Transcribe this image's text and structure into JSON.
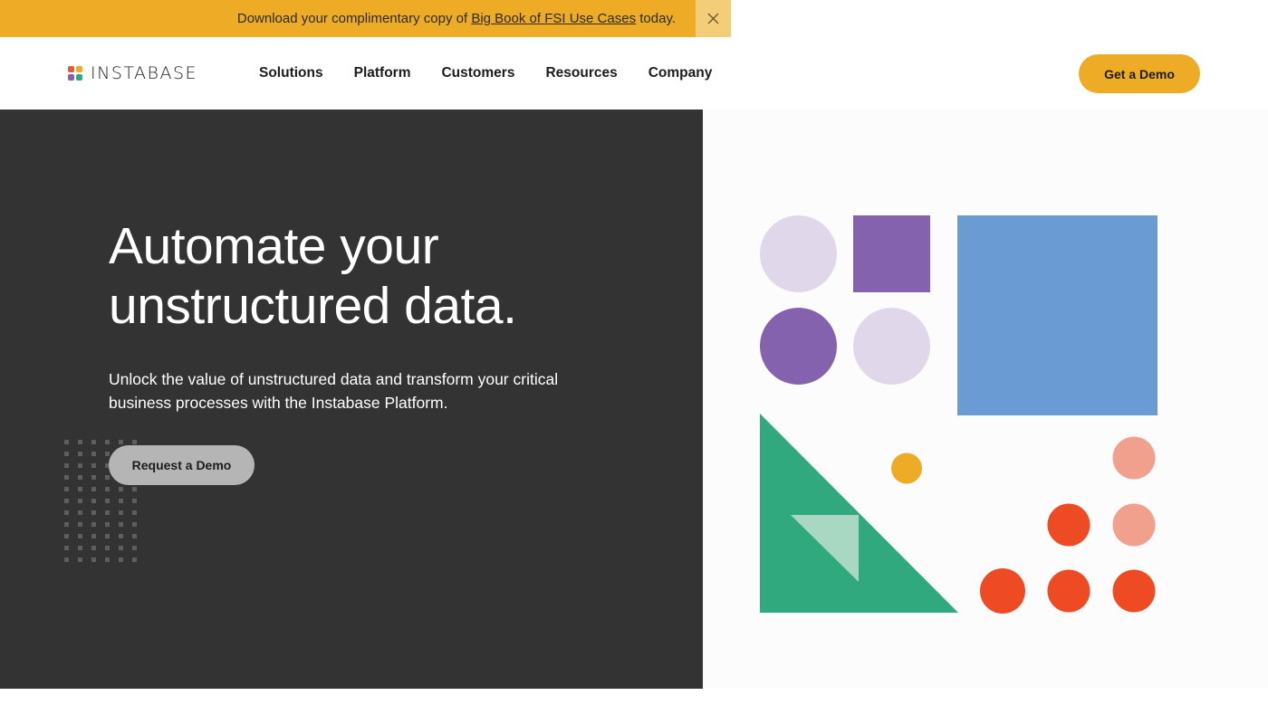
{
  "banner": {
    "text_before": "Download your complimentary copy of ",
    "link_text": "Big Book of FSI Use Cases",
    "text_after": " today.",
    "close_icon": "close-icon",
    "background": "#EEAC26"
  },
  "header": {
    "logo_text": "INSTABASE",
    "logo_colors": [
      "#E85A3A",
      "#EEAC26",
      "#8562AE",
      "#31A97E"
    ],
    "nav": [
      "Solutions",
      "Platform",
      "Customers",
      "Resources",
      "Company"
    ],
    "cta_label": "Get a Demo"
  },
  "hero": {
    "title_line1": "Automate your",
    "title_line2": "unstructured data.",
    "subtitle": "Unlock the value of unstructured data and transform your critical business processes with the Instabase Platform.",
    "cta_label": "Request a Demo",
    "background": "#333333"
  },
  "illustration": {
    "colors": {
      "lavender": "#E0D8EA",
      "purple": "#8562AE",
      "blue": "#6A9BD3",
      "green": "#31A97E",
      "mint": "#A8D8C1",
      "gold": "#EEAC26",
      "salmon": "#F1A08E",
      "red": "#EE4A23"
    }
  }
}
